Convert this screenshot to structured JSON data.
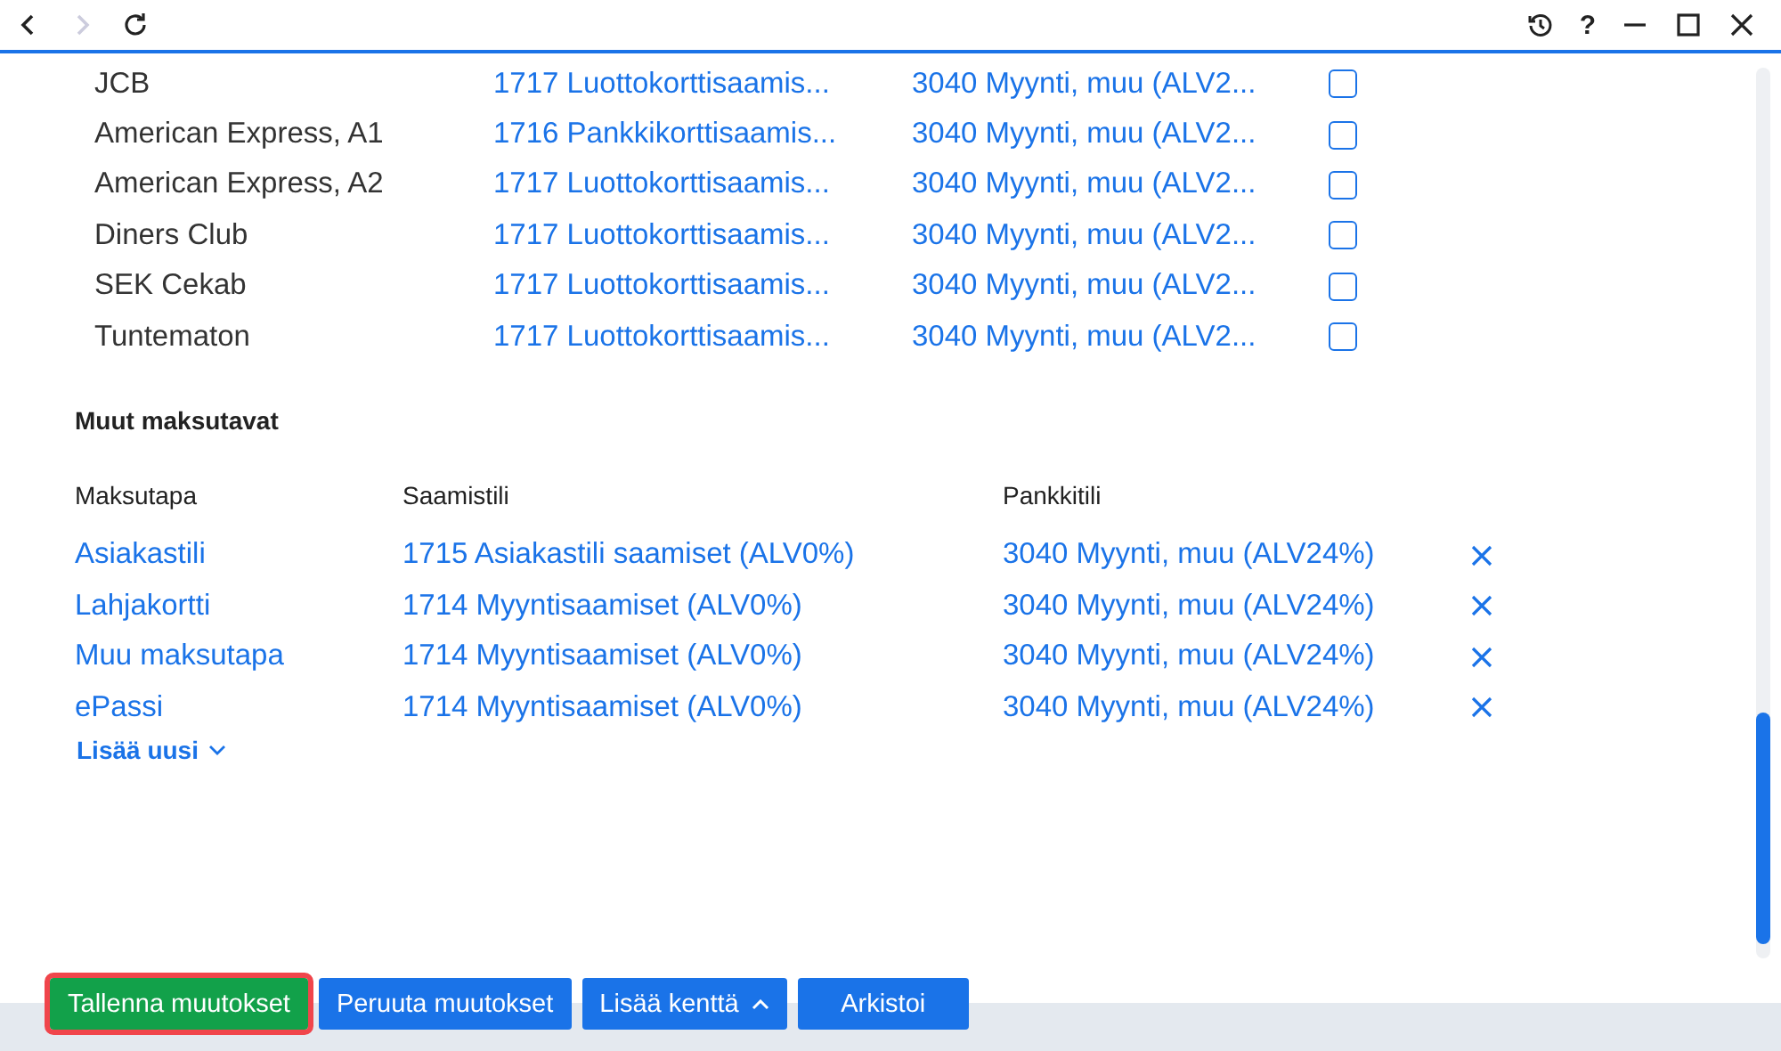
{
  "toolbar": {
    "back": {
      "disabled": false
    },
    "forward": {
      "disabled": true
    },
    "help": "?"
  },
  "card_rows": [
    {
      "name": "JCB",
      "account": "1717 Luottokorttisaamis...",
      "bank": "3040 Myynti, muu (ALV2...",
      "checked": false
    },
    {
      "name": "American Express, A1",
      "account": "1716 Pankkikorttisaamis...",
      "bank": "3040 Myynti, muu (ALV2...",
      "checked": false
    },
    {
      "name": "American Express, A2",
      "account": "1717 Luottokorttisaamis...",
      "bank": "3040 Myynti, muu (ALV2...",
      "checked": false
    },
    {
      "name": "Diners Club",
      "account": "1717 Luottokorttisaamis...",
      "bank": "3040 Myynti, muu (ALV2...",
      "checked": false
    },
    {
      "name": "SEK Cekab",
      "account": "1717 Luottokorttisaamis...",
      "bank": "3040 Myynti, muu (ALV2...",
      "checked": false
    },
    {
      "name": "Tuntematon",
      "account": "1717 Luottokorttisaamis...",
      "bank": "3040 Myynti, muu (ALV2...",
      "checked": false
    }
  ],
  "other_methods": {
    "title": "Muut maksutavat",
    "columns": [
      "Maksutapa",
      "Saamistili",
      "Pankkitili"
    ],
    "rows": [
      {
        "method": "Asiakastili",
        "account": "1715 Asiakastili saamiset (ALV0%)",
        "bank": "3040 Myynti, muu (ALV24%)"
      },
      {
        "method": "Lahjakortti",
        "account": "1714 Myyntisaamiset (ALV0%)",
        "bank": "3040 Myynti, muu (ALV24%)"
      },
      {
        "method": "Muu maksutapa",
        "account": "1714 Myyntisaamiset (ALV0%)",
        "bank": "3040 Myynti, muu (ALV24%)"
      },
      {
        "method": "ePassi",
        "account": "1714 Myyntisaamiset (ALV0%)",
        "bank": "3040 Myynti, muu (ALV24%)"
      }
    ],
    "add_new": "Lisää uusi"
  },
  "buttons": [
    {
      "label": "Tallenna muutokset",
      "kind": "save",
      "highlighted": true
    },
    {
      "label": "Peruuta muutokset",
      "kind": "plain",
      "highlighted": false
    },
    {
      "label": "Lisää kenttä",
      "kind": "menu",
      "highlighted": false
    },
    {
      "label": "Arkistoi",
      "kind": "plain",
      "highlighted": false
    }
  ]
}
